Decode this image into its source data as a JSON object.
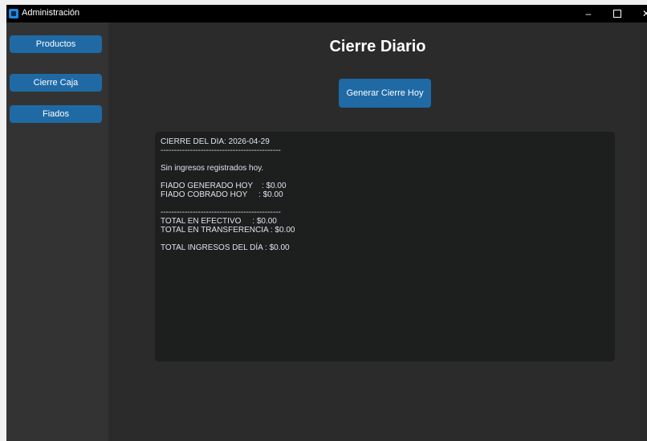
{
  "window": {
    "title": "Administración",
    "minimize_label": "–",
    "close_label": "✕"
  },
  "sidebar": {
    "items": [
      {
        "label": "Productos"
      },
      {
        "label": "Cierre Caja"
      },
      {
        "label": "Fiados"
      }
    ]
  },
  "main": {
    "title": "Cierre Diario",
    "generate_button": "Generar Cierre Hoy",
    "report_text": "CIERRE DEL DÍA: 2026-04-29\n---------------------------------------------\n\nSin ingresos registrados hoy.\n\nFIADO GENERADO HOY    : $0.00\nFIADO COBRADO HOY     : $0.00\n\n---------------------------------------------\nTOTAL EN EFECTIVO     : $0.00\nTOTAL EN TRANSFERENCIA : $0.00\n\nTOTAL INGRESOS DEL DÍA : $0.00"
  },
  "colors": {
    "accent": "#1f6aa5",
    "background": "#2b2b2b",
    "sidebar": "#333333",
    "textbox": "#1d1e1e"
  }
}
